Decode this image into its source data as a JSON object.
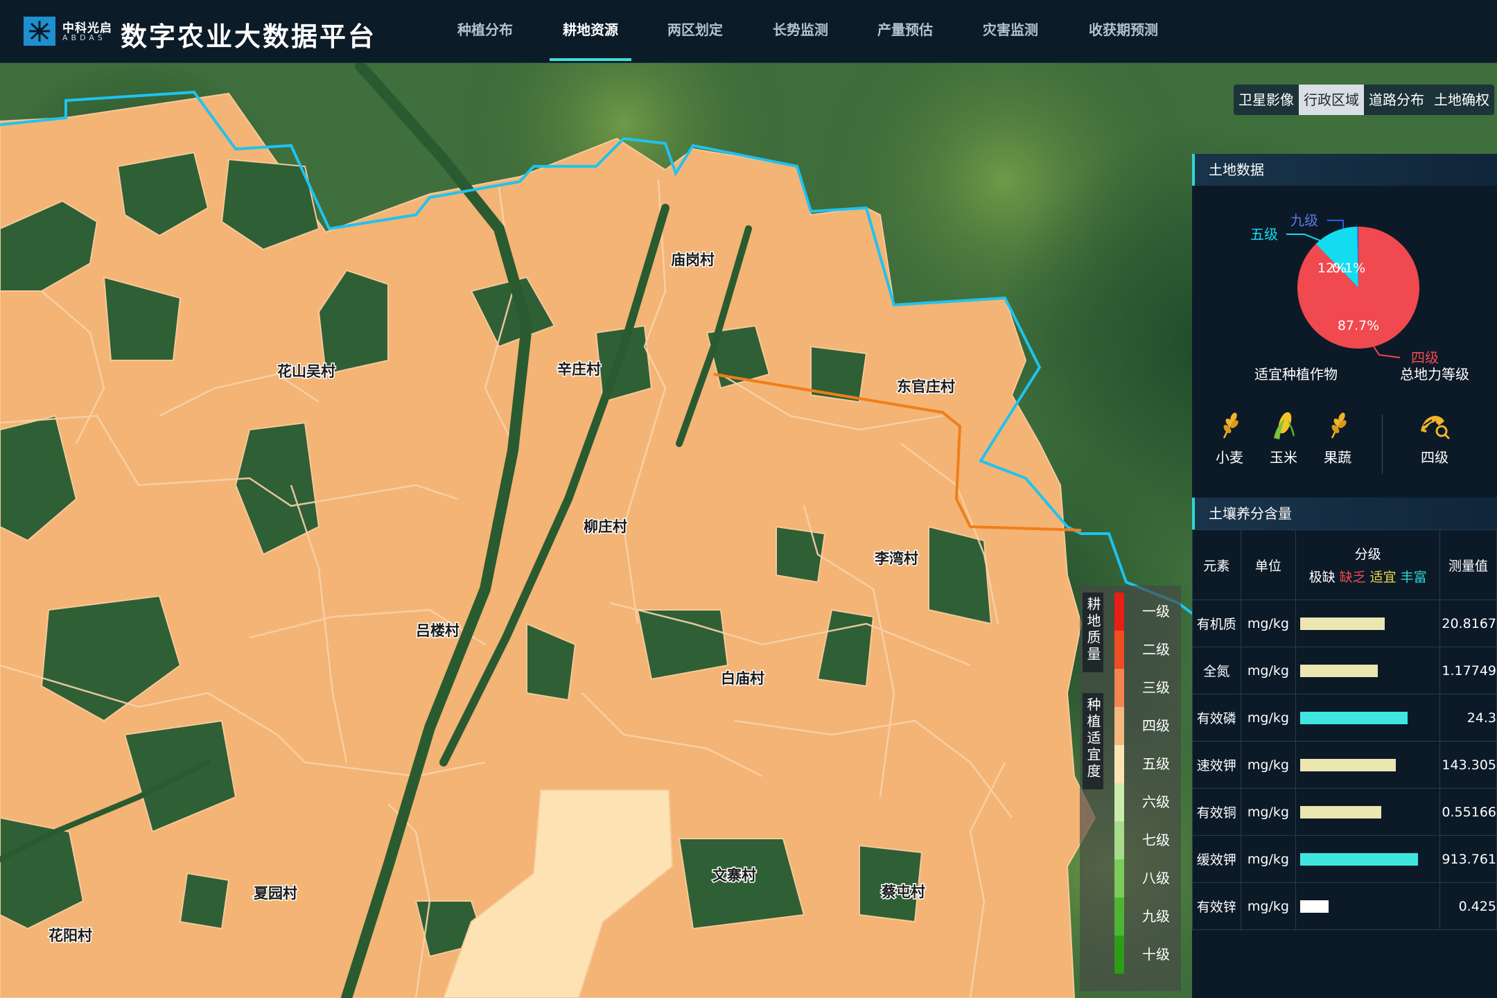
{
  "header": {
    "logo_cn": "中科光启",
    "logo_en": "ABDAS",
    "title": "数字农业大数据平台",
    "tabs": [
      {
        "label": "种植分布",
        "active": false
      },
      {
        "label": "耕地资源",
        "active": true
      },
      {
        "label": "两区划定",
        "active": false
      },
      {
        "label": "长势监测",
        "active": false
      },
      {
        "label": "产量预估",
        "active": false
      },
      {
        "label": "灾害监测",
        "active": false
      },
      {
        "label": "收获期预测",
        "active": false
      }
    ]
  },
  "layers": [
    {
      "label": "卫星影像",
      "active": false
    },
    {
      "label": "行政区域",
      "active": true
    },
    {
      "label": "道路分布",
      "active": false
    },
    {
      "label": "土地确权",
      "active": false
    }
  ],
  "map": {
    "villages": [
      "花山吴村",
      "辛庄村",
      "庙岗村",
      "东官庄村",
      "柳庄村",
      "李湾村",
      "吕楼村",
      "白庙村",
      "文寨村",
      "蔡屯村",
      "夏园村",
      "花阳村"
    ],
    "colors": {
      "parcel": "#f3b475",
      "parcel_light": "#fde3b4",
      "boundary": "#25c4ea",
      "road": "#ef7f1a"
    }
  },
  "land_data": {
    "title": "土地数据",
    "pie": [
      {
        "label": "四级",
        "percent": "87.7%",
        "value": 87.7,
        "color": "#f0494f"
      },
      {
        "label": "五级",
        "percent": "12%",
        "value": 12.0,
        "color": "#14dcf0"
      },
      {
        "label": "九级",
        "percent": "0.1%",
        "value": 0.3,
        "color": "#2b5fd9"
      }
    ],
    "caption_crops": "适宜种植作物",
    "caption_grade": "总地力等级",
    "crops": [
      {
        "label": "小麦",
        "icon": "wheat-icon"
      },
      {
        "label": "玉米",
        "icon": "corn-icon"
      },
      {
        "label": "果蔬",
        "icon": "wheat-icon"
      }
    ],
    "grade": {
      "label": "四级",
      "icon": "land-grade-icon"
    }
  },
  "soil": {
    "title": "土壤养分含量",
    "headers": {
      "element": "元素",
      "unit": "单位",
      "grade": "分级",
      "value": "测量值"
    },
    "grades": [
      {
        "label": "极缺",
        "color": "#ffffff"
      },
      {
        "label": "缺乏",
        "color": "#f0494f"
      },
      {
        "label": "适宜",
        "color": "#f2d84b"
      },
      {
        "label": "丰富",
        "color": "#2fd6d6"
      }
    ],
    "rows": [
      {
        "element": "有机质",
        "unit": "mg/kg",
        "value": "20.8167",
        "level": 0.72,
        "color": "#ece6b0"
      },
      {
        "element": "全氮",
        "unit": "mg/kg",
        "value": "1.17749",
        "level": 0.66,
        "color": "#ece6b0"
      },
      {
        "element": "有效磷",
        "unit": "mg/kg",
        "value": "24.3",
        "level": 0.91,
        "color": "#3fe6e0"
      },
      {
        "element": "速效钾",
        "unit": "mg/kg",
        "value": "143.305",
        "level": 0.81,
        "color": "#ece6b0"
      },
      {
        "element": "有效铜",
        "unit": "mg/kg",
        "value": "0.55166",
        "level": 0.69,
        "color": "#ece6b0"
      },
      {
        "element": "缓效钾",
        "unit": "mg/kg",
        "value": "913.761",
        "level": 1.0,
        "color": "#3fe6e0"
      },
      {
        "element": "有效锌",
        "unit": "mg/kg",
        "value": "0.425",
        "level": 0.24,
        "color": "#ffffff"
      }
    ]
  },
  "legend": {
    "title_quality": "耕地质量",
    "title_suit": "种植适宜度",
    "items": [
      {
        "label": "一级",
        "color": "#e81f14"
      },
      {
        "label": "二级",
        "color": "#ef4e22"
      },
      {
        "label": "三级",
        "color": "#f28552"
      },
      {
        "label": "四级",
        "color": "#f4b880"
      },
      {
        "label": "五级",
        "color": "#fde3b4"
      },
      {
        "label": "六级",
        "color": "#c9ecae"
      },
      {
        "label": "七级",
        "color": "#a7dd8a"
      },
      {
        "label": "八级",
        "color": "#7ccc5c"
      },
      {
        "label": "九级",
        "color": "#4eb534"
      },
      {
        "label": "十级",
        "color": "#2c9d16"
      }
    ]
  }
}
